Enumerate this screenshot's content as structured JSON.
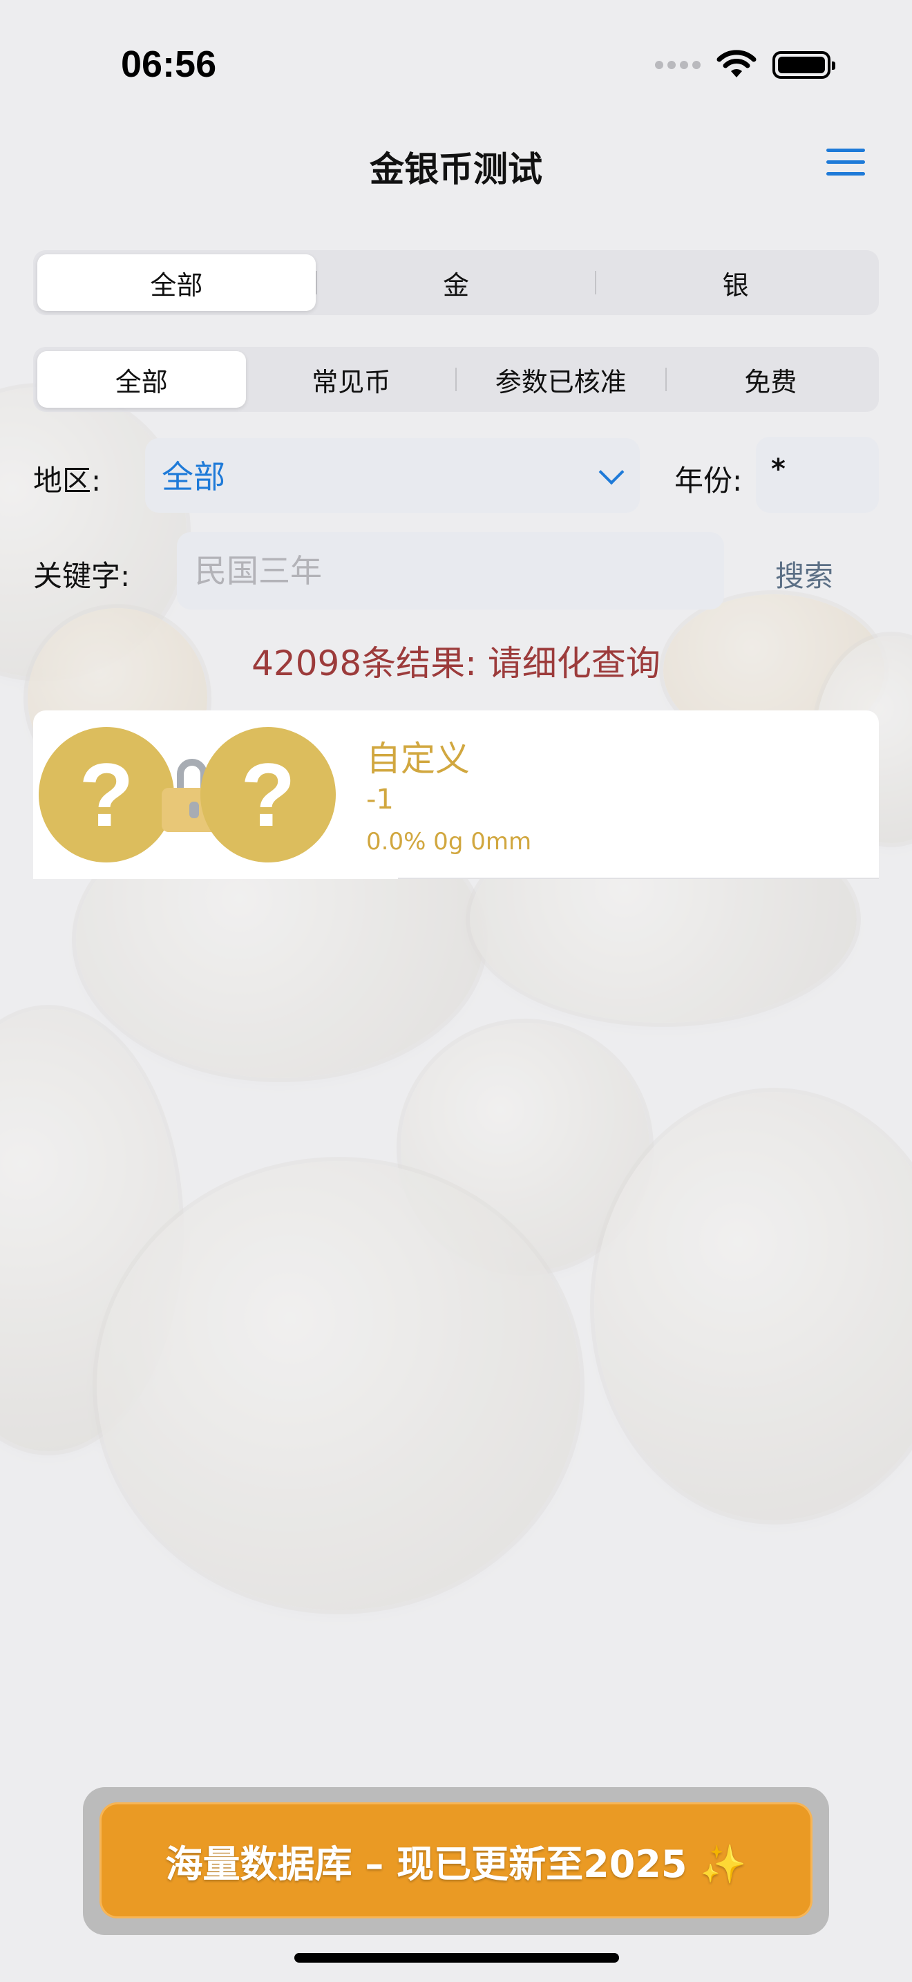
{
  "status": {
    "time": "06:56"
  },
  "nav": {
    "title": "金银币测试",
    "menu_icon": "hamburger-menu-icon"
  },
  "metal_filter": {
    "options": [
      "全部",
      "金",
      "银"
    ],
    "selected": "全部"
  },
  "category_filter": {
    "options": [
      "全部",
      "常见币",
      "参数已核准",
      "免费"
    ],
    "selected": "全部"
  },
  "region": {
    "label": "地区:",
    "value": "全部"
  },
  "year": {
    "label": "年份:",
    "value": "*"
  },
  "keyword": {
    "label": "关键字:",
    "placeholder": "民国三年",
    "value": ""
  },
  "search_label": "搜索",
  "result_count": "42098条结果: 请细化查询",
  "results": [
    {
      "title": "自定义",
      "subtitle": "-1",
      "meta": "0.0% 0g 0mm",
      "obverse": "?",
      "reverse": "?"
    }
  ],
  "banner": {
    "text": "海量数据库 – 现已更新至2025 ✨"
  },
  "colors": {
    "accent": "#1e7ad8",
    "gold": "#d1a73f",
    "result_count": "#9c3b3b",
    "banner": "#ea9a24"
  }
}
